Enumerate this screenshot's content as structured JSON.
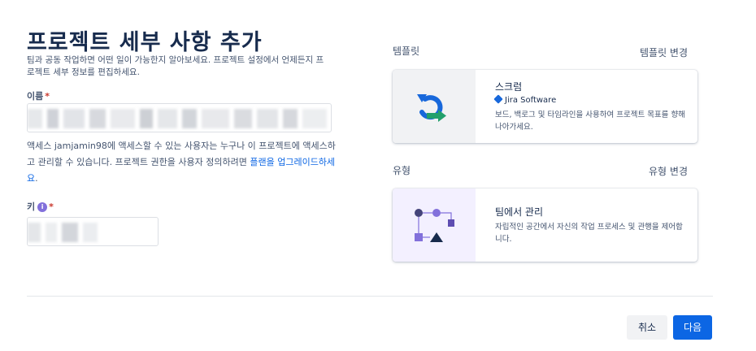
{
  "header": {
    "title": "프로젝트 세부 사항 추가",
    "description": "팀과 공동 작업하면 어떤 일이 가능한지 알아보세요. 프로젝트 설정에서 언제든지 프로젝트 세부 정보를 편집하세요."
  },
  "form": {
    "name_label": "이름",
    "required_mark": "*",
    "access_text_1": "액세스 jamjamin98에 액세스할 수 있는 사용자는 누구나 이 프로젝트에 액세스하고 관리할 수 있습니다. 프로젝트 권한을 사용자 정의하려면 ",
    "access_link": "플랜을 업그레이드하세요",
    "access_text_2": ".",
    "key_label": "키",
    "info_glyph": "i"
  },
  "template": {
    "section_label": "템플릿",
    "change_label": "템플릿 변경",
    "card": {
      "title": "스크럼",
      "product": "Jira Software",
      "description": "보드, 백로그 및 타임라인을 사용하여 프로젝트 목표를 향해 나아가세요."
    }
  },
  "type": {
    "section_label": "유형",
    "change_label": "유형 변경",
    "card": {
      "title": "팀에서 관리",
      "description": "자립적인 공간에서 자신의 작업 프로세스 및 관행을 제어합니다."
    }
  },
  "footer": {
    "cancel_label": "취소",
    "next_label": "다음"
  },
  "colors": {
    "primary": "#0c66e4",
    "scrum_thumb_bg": "#f1f2f4",
    "team_thumb_bg": "#f3f0ff",
    "info_icon": "#8270db"
  },
  "icons": {
    "scrum": "scrum-cycle-icon",
    "team": "team-managed-workflow-icon",
    "product": "jira-diamond-icon",
    "info": "info-icon"
  }
}
